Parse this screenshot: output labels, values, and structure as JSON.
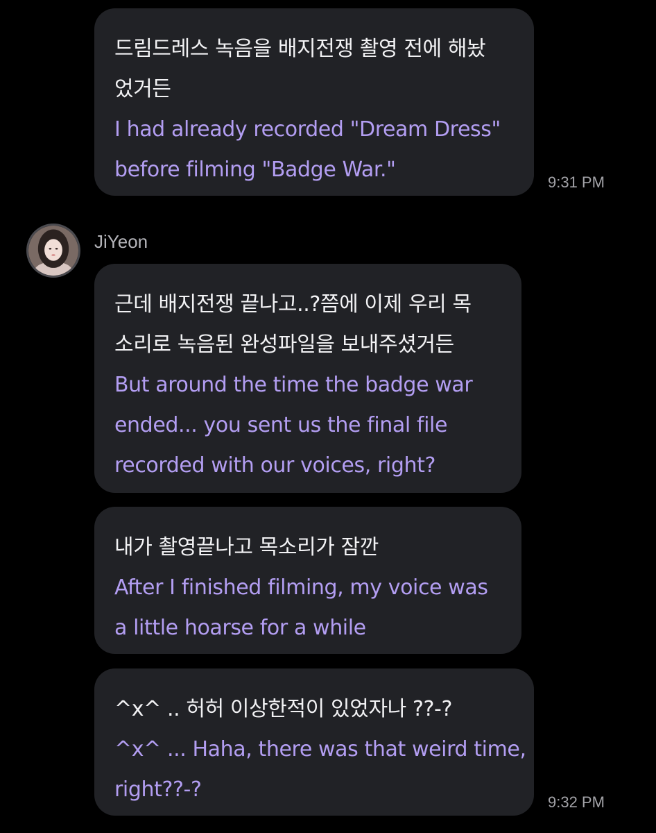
{
  "messages": [
    {
      "korean": [
        "드림드레스 녹음을 배지전쟁 촬영 전에 해놨",
        "었거든"
      ],
      "english": [
        "I had already recorded \"Dream Dress\"",
        "before filming \"Badge War.\""
      ],
      "time": "9:31 PM"
    },
    {
      "sender": "JiYeon",
      "korean": [
        "근데 배지전쟁 끝나고..?쯤에 이제 우리 목",
        "소리로 녹음된 완성파일을 보내주셨거든"
      ],
      "english": [
        "But around the time the badge war",
        "ended... you sent us the final file",
        "recorded with our voices, right?"
      ]
    },
    {
      "korean": [
        "내가 촬영끝나고 목소리가 잠깐"
      ],
      "english": [
        "After I finished filming, my voice was",
        "a little hoarse for a while"
      ]
    },
    {
      "korean": [
        "^x^ .. 허허 이상한적이 있었자나 ??-?"
      ],
      "english": [
        "^x^ ... Haha, there was that weird time,",
        "right??-?"
      ],
      "time": "9:32 PM"
    }
  ],
  "colors": {
    "background": "#000000",
    "bubble": "#212226",
    "korean_text": "#f2f2f4",
    "translation_text": "#b39ef2",
    "timestamp": "#a3a3a8"
  }
}
